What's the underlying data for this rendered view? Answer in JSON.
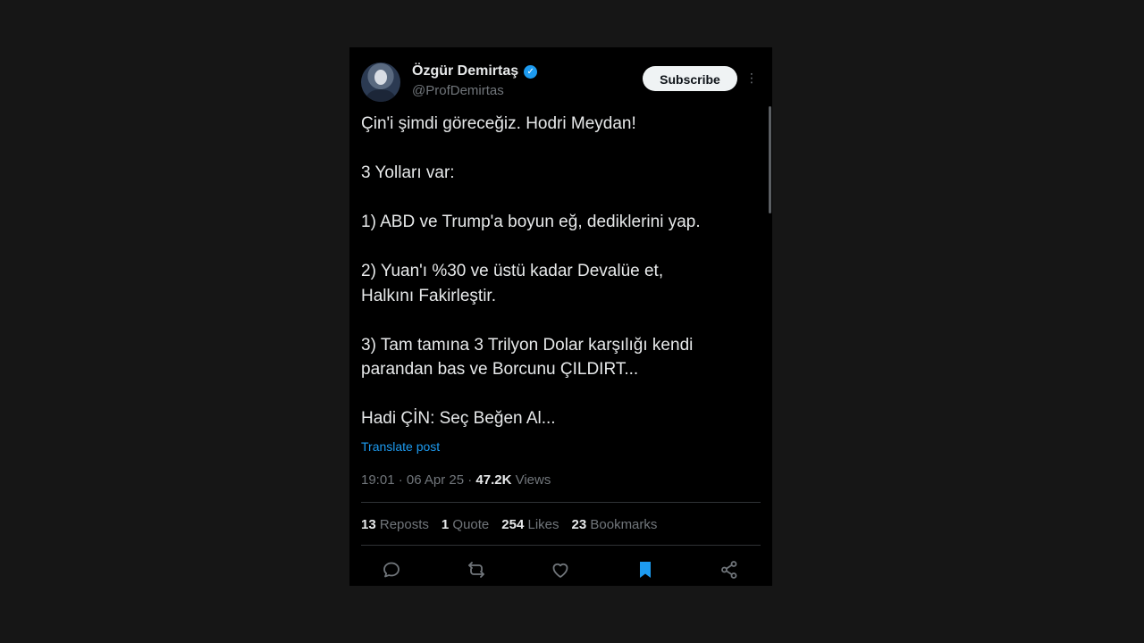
{
  "tweet": {
    "author": {
      "display_name": "Özgür Demirtaş",
      "verified": true,
      "handle": "@ProfDemirtas"
    },
    "subscribe_label": "Subscribe",
    "more_label": "⋮",
    "body": {
      "p1": "Çin'i şimdi göreceğiz. Hodri Meydan!",
      "p2": "3 Yolları var:",
      "p3": "1) ABD ve Trump'a boyun eğ, dediklerini yap.",
      "p4": "2) Yuan'ı %30 ve üstü kadar Devalüe et,\nHalkını Fakirleştir.",
      "p5": "3) Tam tamına 3 Trilyon Dolar karşılığı kendi\nparandan bas ve Borcunu ÇILDIRT...",
      "p6": "Hadi ÇİN: Seç Beğen Al..."
    },
    "translate_label": "Translate post",
    "meta": {
      "time": "19:01 · 06 Apr 25 · ",
      "views_count": "47.2K",
      "views_label": " Views"
    },
    "stats": {
      "reposts_count": "13",
      "reposts_label": "Reposts",
      "quotes_count": "1",
      "quotes_label": "Quote",
      "likes_count": "254",
      "likes_label": "Likes",
      "bookmarks_count": "23",
      "bookmarks_label": "Bookmarks"
    },
    "actions": [
      "reply-icon",
      "repost-icon",
      "like-icon",
      "bookmark-icon",
      "share-icon"
    ]
  },
  "colors": {
    "page_bg": "#161616",
    "card_bg": "#000000",
    "accent": "#1d9bf0",
    "text_primary": "#e7e9ea",
    "text_secondary": "#71767b"
  }
}
